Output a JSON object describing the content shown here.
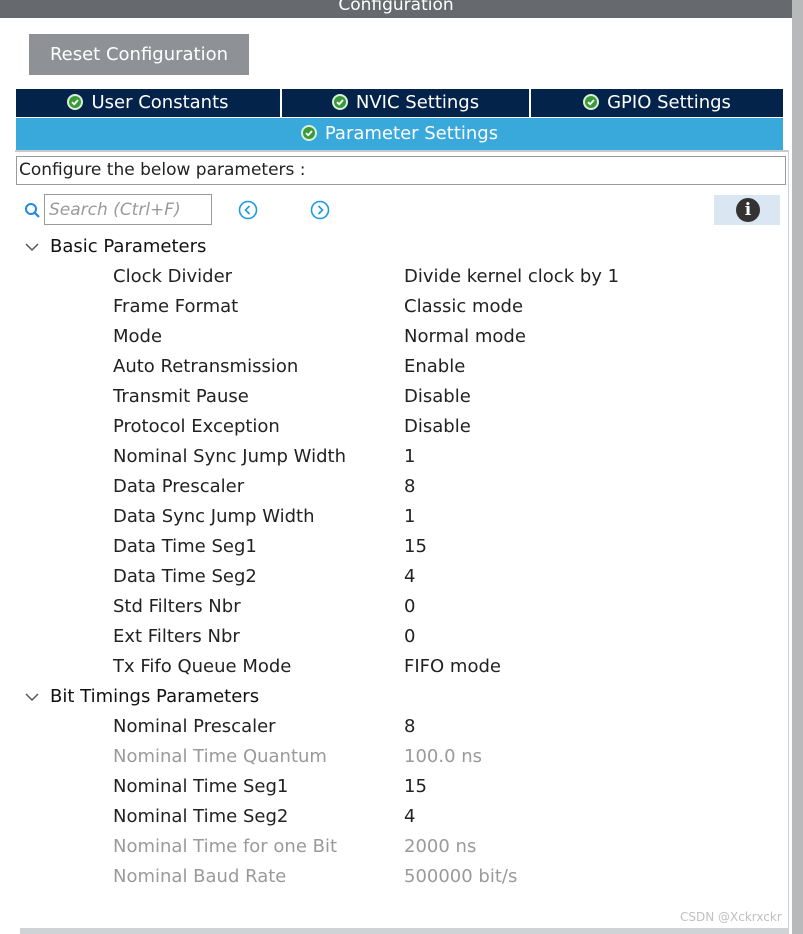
{
  "window": {
    "title": "Configuration"
  },
  "toolbar": {
    "reset_label": "Reset Configuration"
  },
  "tabs": [
    {
      "label": "User Constants",
      "active": false
    },
    {
      "label": "NVIC Settings",
      "active": false
    },
    {
      "label": "GPIO Settings",
      "active": false
    },
    {
      "label": "Parameter Settings",
      "active": true
    }
  ],
  "configure_text": "Configure the below parameters :",
  "search": {
    "placeholder": "Search (Ctrl+F)"
  },
  "groups": [
    {
      "label": "Basic Parameters",
      "params": [
        {
          "name": "Clock Divider",
          "value": "Divide kernel clock by 1",
          "enabled": true
        },
        {
          "name": "Frame Format",
          "value": "Classic mode",
          "enabled": true
        },
        {
          "name": "Mode",
          "value": "Normal mode",
          "enabled": true
        },
        {
          "name": "Auto Retransmission",
          "value": "Enable",
          "enabled": true
        },
        {
          "name": "Transmit Pause",
          "value": "Disable",
          "enabled": true
        },
        {
          "name": "Protocol Exception",
          "value": "Disable",
          "enabled": true
        },
        {
          "name": "Nominal Sync Jump Width",
          "value": "1",
          "enabled": true
        },
        {
          "name": "Data Prescaler",
          "value": "8",
          "enabled": true
        },
        {
          "name": "Data Sync Jump Width",
          "value": "1",
          "enabled": true
        },
        {
          "name": "Data Time Seg1",
          "value": "15",
          "enabled": true
        },
        {
          "name": "Data Time Seg2",
          "value": "4",
          "enabled": true
        },
        {
          "name": "Std Filters Nbr",
          "value": "0",
          "enabled": true
        },
        {
          "name": "Ext Filters Nbr",
          "value": "0",
          "enabled": true
        },
        {
          "name": "Tx Fifo Queue Mode",
          "value": "FIFO mode",
          "enabled": true
        }
      ]
    },
    {
      "label": "Bit Timings Parameters",
      "params": [
        {
          "name": "Nominal Prescaler",
          "value": "8",
          "enabled": true
        },
        {
          "name": "Nominal Time Quantum",
          "value": "100.0 ns",
          "enabled": false
        },
        {
          "name": "Nominal Time Seg1",
          "value": "15",
          "enabled": true
        },
        {
          "name": "Nominal Time Seg2",
          "value": "4",
          "enabled": true
        },
        {
          "name": "Nominal Time for one Bit",
          "value": "2000 ns",
          "enabled": false
        },
        {
          "name": "Nominal Baud Rate",
          "value": "500000 bit/s",
          "enabled": false
        }
      ]
    }
  ],
  "watermark": "CSDN @Xckrxckr"
}
